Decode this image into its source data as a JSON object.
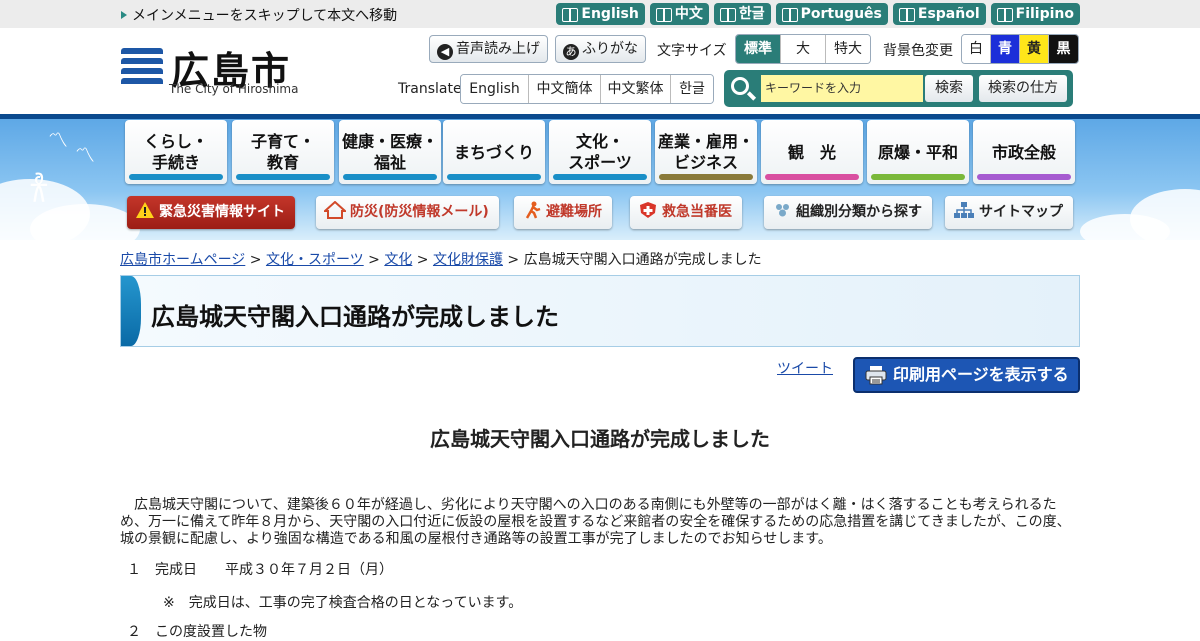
{
  "skip_link": "メインメニューをスキップして本文へ移動",
  "languages": [
    "English",
    "中文",
    "한글",
    "Português",
    "Español",
    "Filipino"
  ],
  "logo": {
    "title": "広島市",
    "subtitle": "The City of Hiroshima"
  },
  "tools": {
    "read_aloud": "音声読み上げ",
    "furigana": "ふりがな",
    "furigana_icon": "あ",
    "font_size_label": "文字サイズ",
    "font_sizes": [
      "標準",
      "大",
      "特大"
    ],
    "bg_label": "背景色変更",
    "bg_colors": [
      "白",
      "青",
      "黄",
      "黒"
    ],
    "translate_label": "Translate",
    "translate_options": [
      "English",
      "中文簡体",
      "中文繁体",
      "한글"
    ]
  },
  "search": {
    "placeholder": "キーワードを入力",
    "button": "検索",
    "howto": "検索の仕方"
  },
  "nav": [
    {
      "label": "くらし・\n手続き",
      "color": "#1a8fc7"
    },
    {
      "label": "子育て・\n教育",
      "color": "#1a8fc7"
    },
    {
      "label": "健康・医療・\n福祉",
      "color": "#1a8fc7"
    },
    {
      "label": "まちづくり",
      "color": "#1a8fc7"
    },
    {
      "label": "文化・\nスポーツ",
      "color": "#1a8fc7"
    },
    {
      "label": "産業・雇用・\nビジネス",
      "color": "#8a7a3a"
    },
    {
      "label": "観　光",
      "color": "#d94fa0"
    },
    {
      "label": "原爆・平和",
      "color": "#7ab83a"
    },
    {
      "label": "市政全般",
      "color": "#a65bd0"
    }
  ],
  "quick_links": [
    "緊急災害情報サイト",
    "防災(防災情報メール)",
    "避難場所",
    "救急当番医",
    "組織別分類から探す",
    "サイトマップ"
  ],
  "breadcrumb": [
    "広島市ホームページ",
    "文化・スポーツ",
    "文化",
    "文化財保護"
  ],
  "breadcrumb_current": "広島城天守閣入口通路が完成しました",
  "breadcrumb_sep": ">",
  "page_title": "広島城天守閣入口通路が完成しました",
  "tweet": "ツイート",
  "print_button": "印刷用ページを表示する",
  "article": {
    "heading": "広島城天守閣入口通路が完成しました",
    "paragraph": "　広島城天守閣について、建築後６０年が経過し、劣化により天守閣への入口のある南側にも外壁等の一部がはく離・はく落することも考えられるため、万一に備えて昨年８月から、天守閣の入口付近に仮設の屋根を設置するなど来館者の安全を確保するための応急措置を講じてきましたが、この度、城の景観に配慮し、より強固な構造である和風の屋根付き通路等の設置工事が完了しましたのでお知らせします。",
    "item1": "１　完成日　　平成３０年７月２日（月）",
    "note": "※　完成日は、工事の完了検査合格の日となっています。",
    "item2": "２　この度設置した物"
  }
}
